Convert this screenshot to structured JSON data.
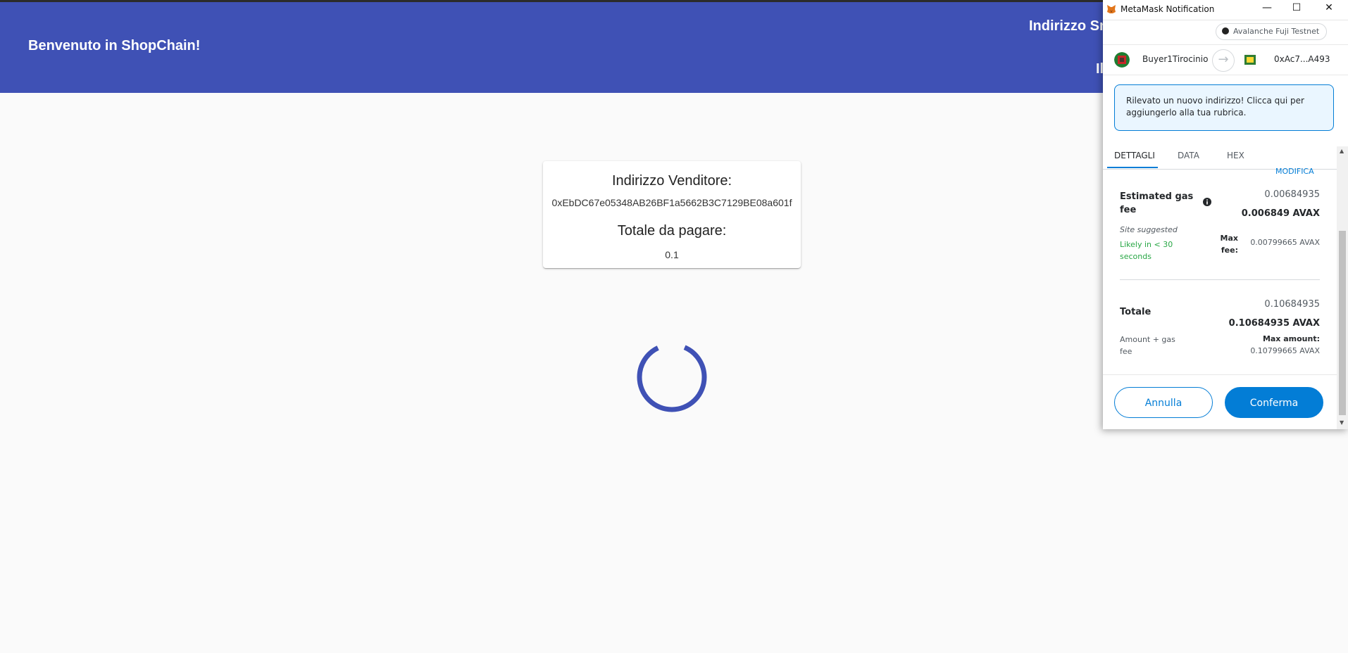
{
  "app": {
    "title": "Benvenuto in ShopChain!",
    "right_title": "Indirizzo Sm",
    "right_sub": "Il"
  },
  "card": {
    "seller_label": "Indirizzo Venditore:",
    "seller_address": "0xEbDC67e05348AB26BF1a5662B3C7129BE08a601f",
    "total_label": "Totale da pagare:",
    "total_value": "0.1"
  },
  "colors": {
    "appbar": "#3f51b5",
    "spinner": "#3f51b5",
    "mm_blue": "#037dd6",
    "mm_green": "#28a745"
  },
  "metamask": {
    "window_title": "MetaMask Notification",
    "window_controls": {
      "minimize": "—",
      "maximize": "☐",
      "close": "✕"
    },
    "network": "Avalanche Fuji Testnet",
    "from_account": "Buyer1Tirocinio",
    "to_account": "0xAc7...A493",
    "notice": "Rilevato un nuovo indirizzo! Clicca qui per aggiungerlo alla tua rubrica.",
    "tabs": [
      "DETTAGLI",
      "DATA",
      "HEX"
    ],
    "edit_link": "MODIFICA",
    "gas": {
      "label": "Estimated gas fee",
      "value": "0.00684935",
      "value_bold": "0.006849 AVAX",
      "site_suggested": "Site suggested",
      "likely": "Likely in < 30 seconds",
      "max_fee_label": "Max fee:",
      "max_fee_value": "0.00799665 AVAX"
    },
    "total": {
      "label": "Totale",
      "value": "0.10684935",
      "value_bold": "0.10684935 AVAX",
      "sub": "Amount + gas fee",
      "max_amount_label": "Max amount:",
      "max_amount_value": "0.10799665 AVAX"
    },
    "buttons": {
      "cancel": "Annulla",
      "confirm": "Conferma"
    }
  }
}
